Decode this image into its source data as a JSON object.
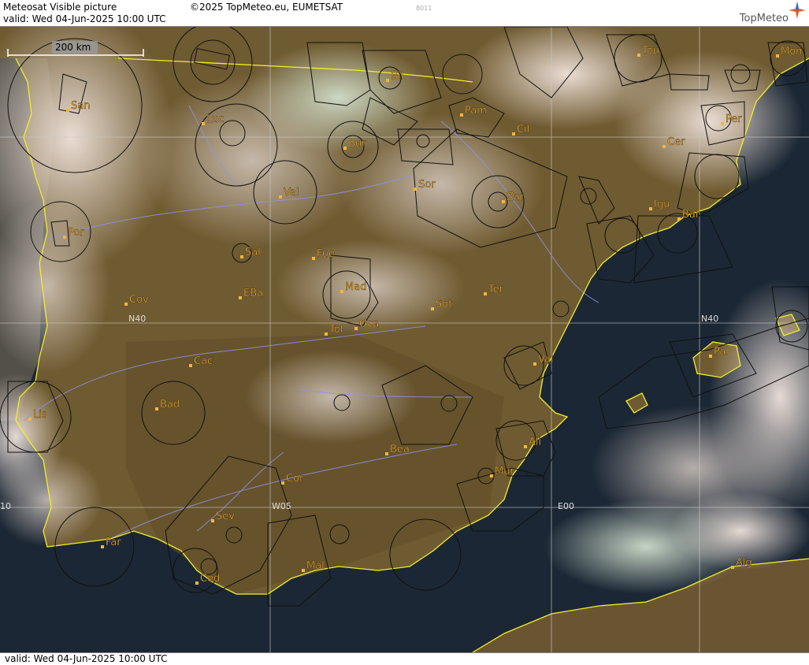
{
  "header": {
    "title": "Meteosat Visible picture",
    "valid": "valid:  Wed  04-Jun-2025  10:00 UTC",
    "copyright": "©2025 TopMeteo.eu, EUMETSAT",
    "code": "8011",
    "brand": "TopMeteo"
  },
  "footer": {
    "valid": "valid:  Wed  04-Jun-2025  10:00 UTC"
  },
  "scale": {
    "label": "200 km"
  },
  "grid_labels": {
    "n40_west": "N40",
    "n40_east": "N40",
    "w05": "W05",
    "e00": "E00",
    "w10": "10"
  },
  "stations": [
    "San",
    "Luc",
    "Bil",
    "Pam",
    "Cil",
    "Bur",
    "Per",
    "Cer",
    "Sor",
    "Val",
    "Zar",
    "Igu",
    "Bar",
    "Por",
    "Sal",
    "Fue",
    "Mad",
    "Cov",
    "EBa",
    "Ter",
    "Sot",
    "Tol",
    "Oca",
    "Cac",
    "Val",
    "Bad",
    "Lis",
    "Ali",
    "Bea",
    "Mur",
    "Cor",
    "Sev",
    "Far",
    "Mal",
    "Ced",
    "Pal",
    "Alg",
    "Tou",
    "Mon"
  ],
  "colors": {
    "land": "#6e5a30",
    "sea": "#1a2633",
    "coastline": "#f2ee2a",
    "station_label": "#f5b53a",
    "airspace": "#111111",
    "grid": "#c8c8c8",
    "rivers": "#8f92e8"
  }
}
